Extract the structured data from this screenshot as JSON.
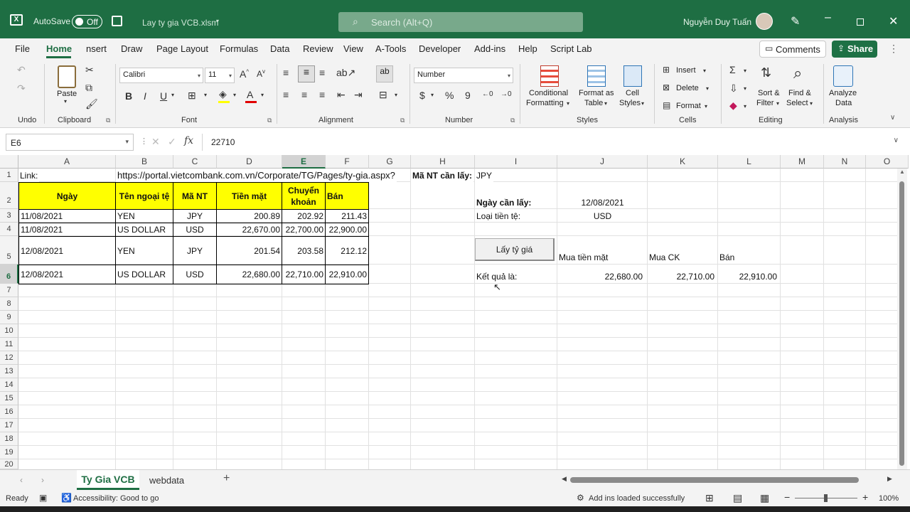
{
  "titlebar": {
    "autosave_label": "AutoSave",
    "autosave_state": "Off",
    "filename": "Lay ty gia VCB.xlsm",
    "search_placeholder": "Search (Alt+Q)",
    "user_name": "Nguyễn Duy Tuấn"
  },
  "menu": {
    "tabs": [
      "File",
      "Home",
      "nsert",
      "Draw",
      "Page Layout",
      "Formulas",
      "Data",
      "Review",
      "View",
      "A-Tools",
      "Developer",
      "Add-ins",
      "Help",
      "Script Lab"
    ],
    "comments_label": "Comments",
    "share_label": "Share"
  },
  "ribbon": {
    "undo_group": "Undo",
    "paste_label": "Paste",
    "clipboard_group": "Clipboard",
    "font_name": "Calibri",
    "font_size": "11",
    "font_group": "Font",
    "alignment_group": "Alignment",
    "number_format": "Number",
    "number_group": "Number",
    "conditional_formatting_1": "Conditional",
    "conditional_formatting_2": "Formatting",
    "format_as_table_1": "Format as",
    "format_as_table_2": "Table",
    "cell_styles_1": "Cell",
    "cell_styles_2": "Styles",
    "styles_group": "Styles",
    "insert_label": "Insert",
    "delete_label": "Delete",
    "format_label": "Format",
    "cells_group": "Cells",
    "sort_filter_1": "Sort &",
    "sort_filter_2": "Filter",
    "find_select_1": "Find &",
    "find_select_2": "Select",
    "editing_group": "Editing",
    "analyze_data_1": "Analyze",
    "analyze_data_2": "Data",
    "analysis_group": "Analysis"
  },
  "formula_bar": {
    "name_box": "E6",
    "fx": "fx",
    "value": "22710"
  },
  "columns": [
    "A",
    "B",
    "C",
    "D",
    "E",
    "F",
    "G",
    "H",
    "I",
    "J",
    "K",
    "L",
    "M",
    "N",
    "O"
  ],
  "rows": [
    "1",
    "2",
    "3",
    "4",
    "5",
    "6",
    "7",
    "8",
    "9",
    "10",
    "11",
    "12",
    "13",
    "14",
    "15",
    "16",
    "17",
    "18",
    "19",
    "20"
  ],
  "sheet": {
    "link_label": "Link:",
    "link_url": "https://portal.vietcombank.com.vn/Corporate/TG/Pages/ty-gia.aspx?",
    "ma_nt_label": "Mã NT cần lấy:",
    "ma_nt_value": "JPY",
    "headers": {
      "ngay": "Ngày",
      "ten_ngoai_te": "Tên ngoại tệ",
      "ma_nt": "Mã NT",
      "tien_mat": "Tiền mặt",
      "chuyen_khoan_1": "Chuyển",
      "chuyen_khoan_2": "khoản",
      "ban": "Bán"
    },
    "data_rows": [
      {
        "ngay": "11/08/2021",
        "ten": "YEN",
        "ma": "JPY",
        "tien_mat": "200.89",
        "ck": "202.92",
        "ban": "211.43"
      },
      {
        "ngay": "11/08/2021",
        "ten": "US DOLLAR",
        "ma": "USD",
        "tien_mat": "22,670.00",
        "ck": "22,700.00",
        "ban": "22,900.00"
      },
      {
        "ngay": "12/08/2021",
        "ten": "YEN",
        "ma": "JPY",
        "tien_mat": "201.54",
        "ck": "203.58",
        "ban": "212.12"
      },
      {
        "ngay": "12/08/2021",
        "ten": "US DOLLAR",
        "ma": "USD",
        "tien_mat": "22,680.00",
        "ck": "22,710.00",
        "ban": "22,910.00"
      }
    ],
    "ngay_can_lay_label": "Ngày cần lấy:",
    "ngay_can_lay_value": "12/08/2021",
    "loai_tien_label": "Loại tiền tệ:",
    "loai_tien_value": "USD",
    "button_label": "Lấy tỷ giá",
    "mua_tien_mat_label": "Mua tiền mặt",
    "mua_ck_label": "Mua CK",
    "ban_label": "Bán",
    "ket_qua_label": "Kết quả là:",
    "ket_qua_tien_mat": "22,680.00",
    "ket_qua_ck": "22,710.00",
    "ket_qua_ban": "22,910.00"
  },
  "sheet_tabs": {
    "active": "Ty Gia VCB",
    "other": "webdata"
  },
  "status": {
    "ready": "Ready",
    "accessibility": "Accessibility: Good to go",
    "addins": "Add ins loaded successfully",
    "zoom": "100%"
  },
  "colors": {
    "excel_green": "#1e6e43",
    "header_yellow": "#ffff00",
    "share_button": "#1e7145"
  }
}
